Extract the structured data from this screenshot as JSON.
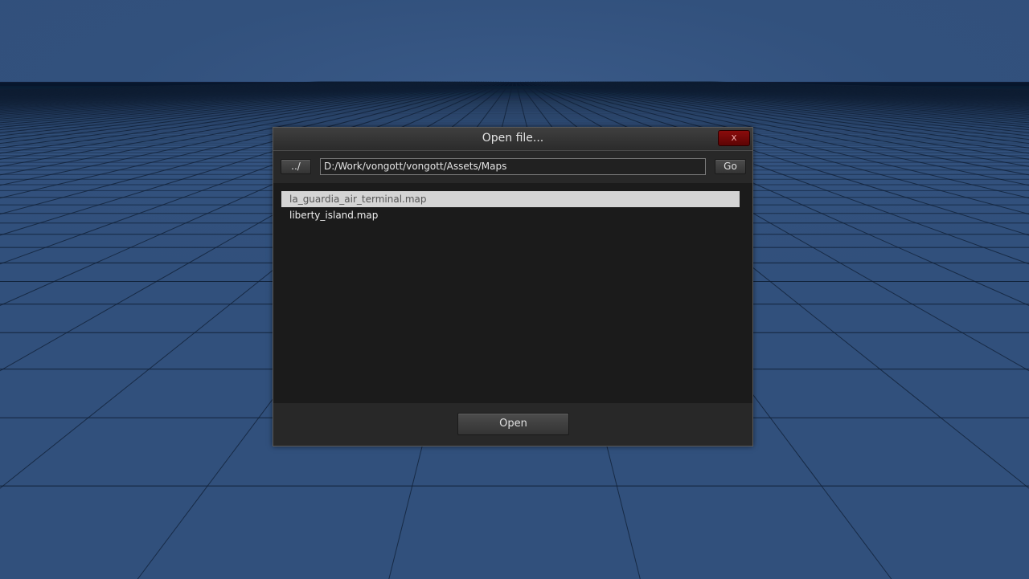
{
  "dialog": {
    "title": "Open file...",
    "close_label": "x",
    "up_label": "../",
    "path_value": "D:/Work/vongott/vongott/Assets/Maps",
    "go_label": "Go",
    "open_label": "Open"
  },
  "files": [
    {
      "name": "la_guardia_air_terminal.map",
      "selected": true
    },
    {
      "name": "liberty_island.map",
      "selected": false
    }
  ],
  "colors": {
    "background": "#31507c",
    "grid_line": "#0f1e33",
    "close_button": "#7a0808",
    "selection": "#d4d4d4"
  }
}
